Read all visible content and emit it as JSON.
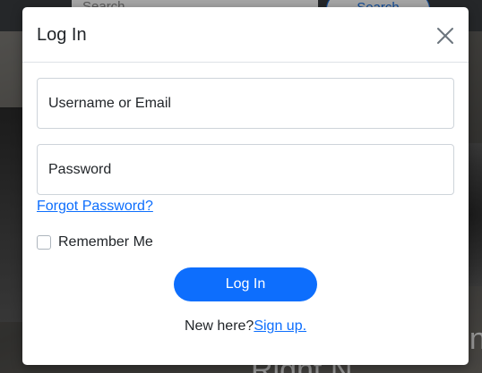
{
  "background": {
    "search_placeholder": "Search",
    "search_button": "Search",
    "hero_text_1": "Right N",
    "hero_text_2": "on"
  },
  "modal": {
    "title": "Log In",
    "close_icon": "close-icon",
    "username_placeholder": "Username or Email",
    "username_value": "",
    "password_placeholder": "Password",
    "password_value": "",
    "forgot_password": "Forgot Password?",
    "remember_me": "Remember Me",
    "remember_checked": false,
    "login_button": "Log In",
    "new_here": "New here?",
    "sign_up": "Sign up."
  },
  "colors": {
    "primary": "#0d6efd",
    "backdrop": "rgba(0,0,0,0.35)"
  }
}
